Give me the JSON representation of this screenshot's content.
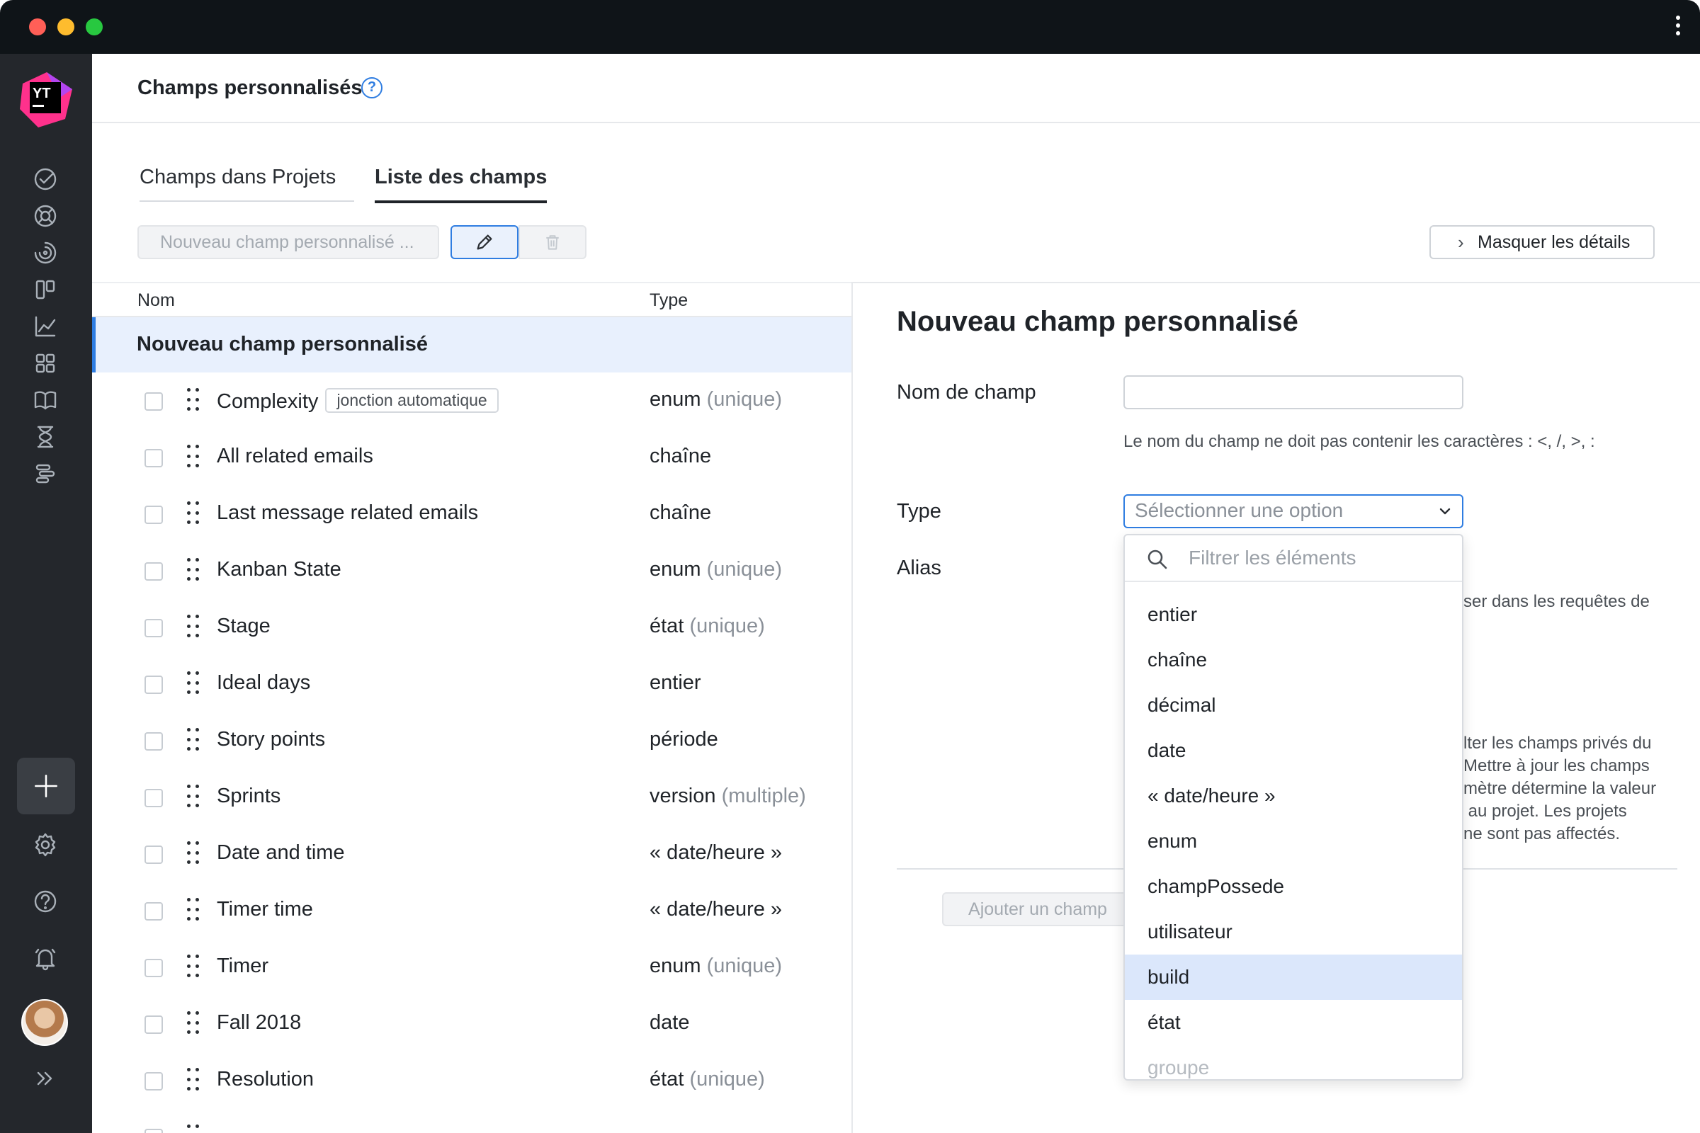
{
  "window": {
    "menu_icon": "kebab-menu-icon"
  },
  "header": {
    "title": "Champs personnalisés",
    "help_label": "?"
  },
  "tabs": [
    {
      "label": "Champs dans Projets"
    },
    {
      "label": "Liste des champs"
    }
  ],
  "toolbar": {
    "new_field_label": "Nouveau champ personnalisé ...",
    "edit_icon": "pencil-icon",
    "delete_icon": "trash-icon",
    "hide_details_label": "Masquer les détails"
  },
  "list": {
    "columns": {
      "name": "Nom",
      "type": "Type"
    },
    "selected": "Nouveau champ personnalisé",
    "rows": [
      {
        "name": "Complexity",
        "badge": "jonction automatique",
        "type": "enum",
        "qualifier": "(unique)"
      },
      {
        "name": "All related emails",
        "badge": "",
        "type": "chaîne",
        "qualifier": ""
      },
      {
        "name": "Last message related emails",
        "badge": "",
        "type": "chaîne",
        "qualifier": ""
      },
      {
        "name": "Kanban State",
        "badge": "",
        "type": "enum",
        "qualifier": "(unique)"
      },
      {
        "name": "Stage",
        "badge": "",
        "type": "état",
        "qualifier": "(unique)"
      },
      {
        "name": "Ideal days",
        "badge": "",
        "type": "entier",
        "qualifier": ""
      },
      {
        "name": "Story points",
        "badge": "",
        "type": "période",
        "qualifier": ""
      },
      {
        "name": "Sprints",
        "badge": "",
        "type": "version",
        "qualifier": "(multiple)"
      },
      {
        "name": "Date and time",
        "badge": "",
        "type": "« date/heure »",
        "qualifier": ""
      },
      {
        "name": "Timer time",
        "badge": "",
        "type": "« date/heure »",
        "qualifier": ""
      },
      {
        "name": "Timer",
        "badge": "",
        "type": "enum",
        "qualifier": "(unique)"
      },
      {
        "name": "Fall 2018",
        "badge": "",
        "type": "date",
        "qualifier": ""
      },
      {
        "name": "Resolution",
        "badge": "",
        "type": "état",
        "qualifier": "(unique)"
      }
    ]
  },
  "details": {
    "title": "Nouveau champ personnalisé",
    "field_name_label": "Nom de champ",
    "field_name_value": "",
    "field_name_hint": "Le nom du champ ne doit pas contenir les caractères : <, /, >, :",
    "type_label": "Type",
    "type_placeholder": "Sélectionner une option",
    "alias_label": "Alias",
    "alias_hint_partial": "ser dans les requêtes de",
    "private_hint_lines": [
      "lter les champs privés du",
      "Mettre à jour les champs",
      "mètre détermine la valeur",
      " au projet. Les projets",
      "ne sont pas affectés."
    ],
    "add_field_label": "Ajouter un champ"
  },
  "dropdown": {
    "filter_placeholder": "Filtrer les éléments",
    "options": [
      "entier",
      "chaîne",
      "décimal",
      "date",
      "« date/heure »",
      "enum",
      "champPossede",
      "utilisateur",
      "build",
      "état",
      "groupe"
    ],
    "highlighted": "build"
  },
  "colors": {
    "accent": "#2f7de1",
    "sidebar": "#24272c",
    "selected_row": "#e8f0fd",
    "highlight_option": "#dbe7fb"
  }
}
